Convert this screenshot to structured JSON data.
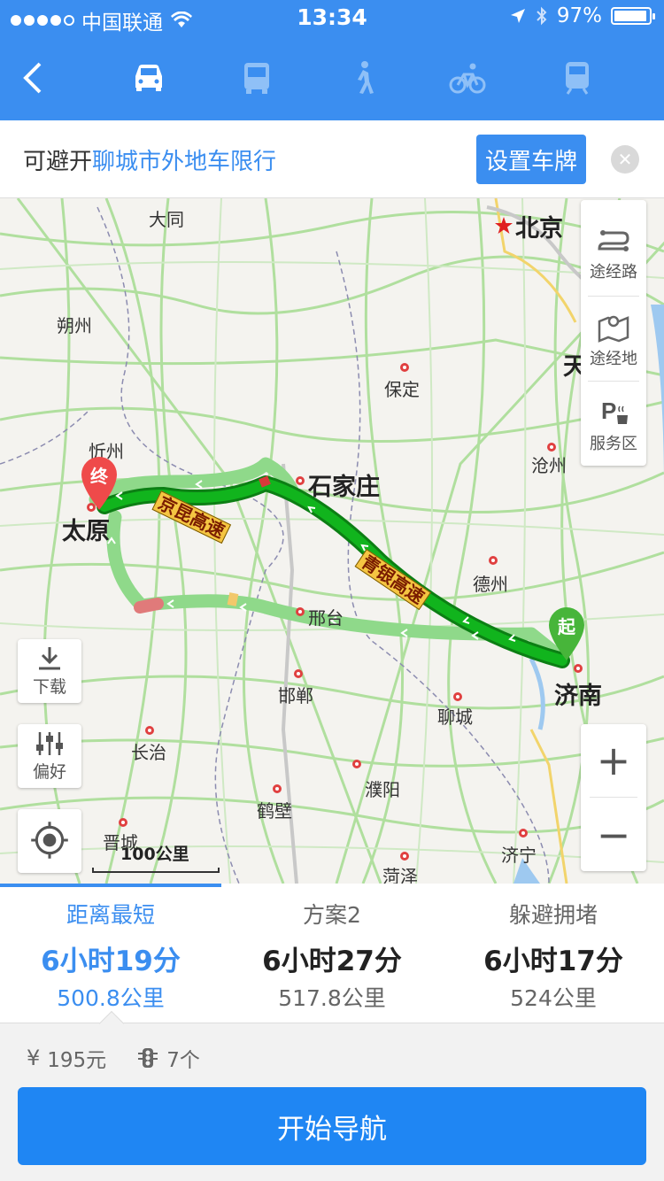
{
  "status_bar": {
    "carrier": "中国联通",
    "time": "13:34",
    "battery": "97%"
  },
  "nav": {
    "back_icon": "chevron-left-icon",
    "modes": [
      {
        "name": "car",
        "icon": "car-icon",
        "active": true
      },
      {
        "name": "bus",
        "icon": "bus-icon",
        "active": false
      },
      {
        "name": "walk",
        "icon": "walk-icon",
        "active": false
      },
      {
        "name": "bike",
        "icon": "bike-icon",
        "active": false
      },
      {
        "name": "train",
        "icon": "train-icon",
        "active": false
      }
    ]
  },
  "banner": {
    "prefix": "可避开",
    "link": "聊城市外地车限行",
    "button": "设置车牌",
    "close": "✕"
  },
  "map": {
    "cities": {
      "datong": "大同",
      "beijing": "北京",
      "shuozhou": "朔州",
      "baoding": "保定",
      "tianjin": "天",
      "xinzhou": "忻州",
      "shijiazhuang": "石家庄",
      "cangzhou": "沧州",
      "taiyuan": "太原",
      "dezhou": "德州",
      "xingtai": "邢台",
      "jinan": "济南",
      "handan": "邯郸",
      "liaocheng": "聊城",
      "changzhi": "长治",
      "puyang": "濮阳",
      "hebi": "鹤壁",
      "jincheng": "晋城",
      "jining": "济宁",
      "heze": "菏泽"
    },
    "road_labels": {
      "jingkun": "京昆高速",
      "qingyin": "青银高速"
    },
    "markers": {
      "end": "终",
      "start": "起"
    },
    "side_panel": [
      {
        "label": "途经路",
        "icon": "route-icon"
      },
      {
        "label": "途经地",
        "icon": "map-place-icon"
      },
      {
        "label": "服务区",
        "icon": "service-area-icon"
      }
    ],
    "download_label": "下载",
    "preference_label": "偏好",
    "locate_icon": "locate-icon",
    "zoom_in": "+",
    "zoom_out": "−",
    "scale": "100公里"
  },
  "routes": [
    {
      "name": "距离最短",
      "duration": "6小时19分",
      "distance": "500.8公里",
      "active": true
    },
    {
      "name": "方案2",
      "duration": "6小时27分",
      "distance": "517.8公里",
      "active": false
    },
    {
      "name": "躲避拥堵",
      "duration": "6小时17分",
      "distance": "524公里",
      "active": false
    }
  ],
  "info": {
    "toll_icon": "¥",
    "toll": "195元",
    "lights_icon": "traffic-light-icon",
    "lights": "7个"
  },
  "start_button": "开始导航",
  "colors": {
    "brand": "#3b8ef0",
    "route_main": "#0ca01a",
    "route_alt": "#8fd98a"
  }
}
